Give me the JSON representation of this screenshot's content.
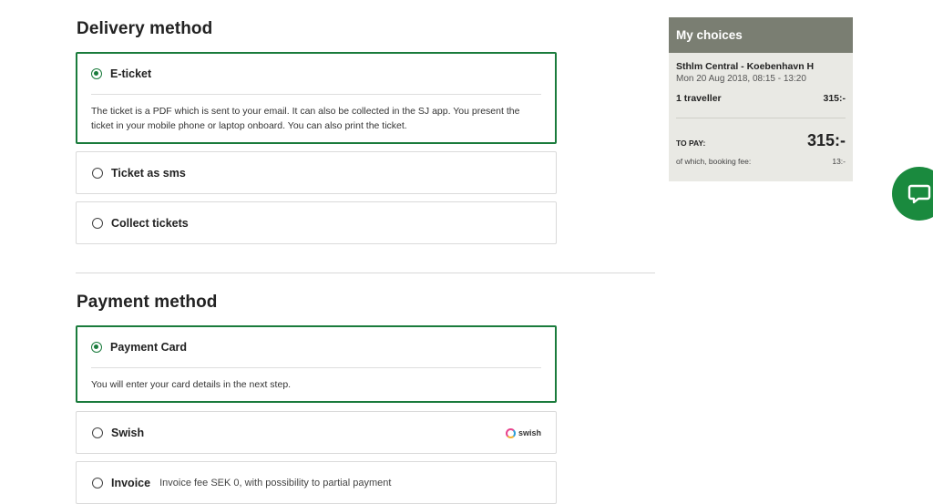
{
  "delivery": {
    "title": "Delivery method",
    "options": [
      {
        "label": "E-ticket",
        "description": "The ticket is a PDF which is sent to your email. It can also be collected in the SJ app. You present the ticket in your mobile phone or laptop onboard. You can also print the ticket.",
        "selected": true
      },
      {
        "label": "Ticket as sms",
        "selected": false
      },
      {
        "label": "Collect tickets",
        "selected": false
      }
    ]
  },
  "payment": {
    "title": "Payment method",
    "options": [
      {
        "label": "Payment Card",
        "description": "You will enter your card details in the next step.",
        "selected": true
      },
      {
        "label": "Swish",
        "logo_text": "swish",
        "selected": false
      },
      {
        "label": "Invoice",
        "sublabel": "Invoice fee SEK 0, with possibility to partial payment",
        "selected": false
      }
    ]
  },
  "summary": {
    "title": "My choices",
    "route": "Sthlm Central - Koebenhavn H",
    "date": "Mon 20 Aug 2018, 08:15 - 13:20",
    "travellers": "1 traveller",
    "traveller_price": "315:-",
    "to_pay_label": "TO PAY:",
    "to_pay_amount": "315:-",
    "fee_label": "of which, booking fee:",
    "fee_amount": "13:-"
  },
  "colors": {
    "accent": "#1a7b3c",
    "summary_header": "#7a7e72",
    "summary_bg": "#e9e9e4"
  },
  "icons": {
    "chat": "chat-bubble-icon",
    "swish": "swish-logo-icon"
  }
}
